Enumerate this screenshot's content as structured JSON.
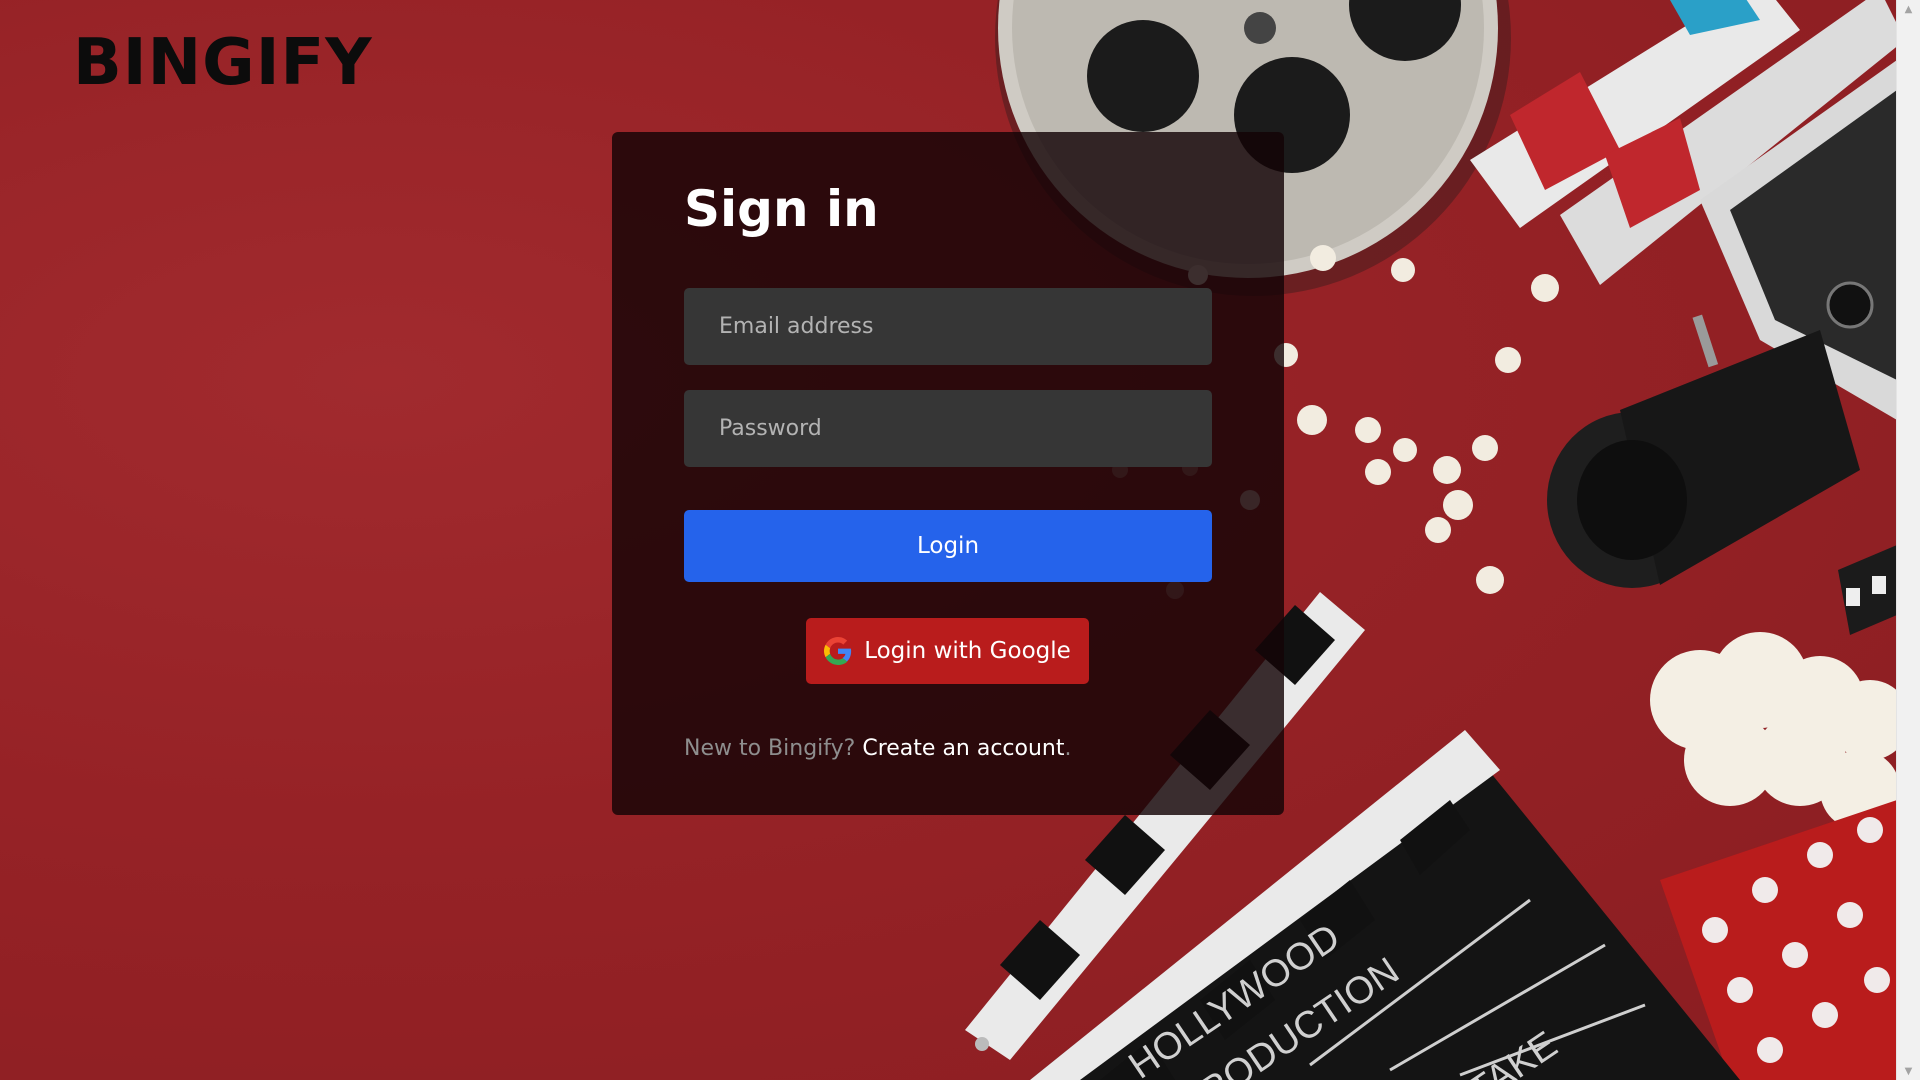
{
  "brand": {
    "logo_text": "BINGIFY"
  },
  "signin": {
    "title": "Sign in",
    "email_placeholder": "Email address",
    "password_placeholder": "Password",
    "login_label": "Login",
    "google_label": "Login with Google",
    "new_prompt": "New to Bingify?",
    "create_link": "Create an account",
    "create_suffix": "."
  },
  "colors": {
    "background": "#962226",
    "card": "#14040699",
    "input": "#363636",
    "login_button": "#2563eb",
    "google_button": "#b91c1c"
  },
  "background_art": {
    "film-reel-icon": "film reel",
    "glasses-3d-icon": "3D glasses",
    "popcorn-icon": "popcorn",
    "movie-camera-icon": "movie camera",
    "clapperboard-icon": "clapperboard",
    "clapper-text-1": "HOLLYWOOD",
    "clapper-text-2": "PRODUCTION",
    "clapper-text-3": "TAKE"
  }
}
